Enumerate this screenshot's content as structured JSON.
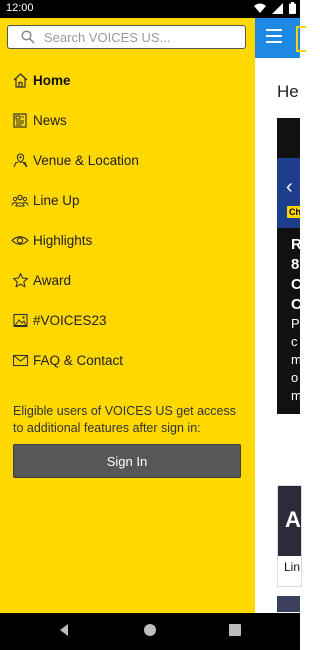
{
  "status_bar": {
    "time": "12:00"
  },
  "drawer": {
    "search": {
      "placeholder": "Search VOICES US..."
    },
    "items": [
      {
        "label": "Home",
        "icon": "home-icon",
        "active": true
      },
      {
        "label": "News",
        "icon": "news-icon"
      },
      {
        "label": "Venue & Location",
        "icon": "location-map-icon"
      },
      {
        "label": "Line Up",
        "icon": "people-icon"
      },
      {
        "label": "Highlights",
        "icon": "eye-icon"
      },
      {
        "label": "Award",
        "icon": "star-icon"
      },
      {
        "label": "#VOICES23",
        "icon": "image-icon"
      },
      {
        "label": "FAQ & Contact",
        "icon": "mail-icon"
      }
    ],
    "info_text": "Eligible users of VOICES US get access to additional features after sign in:",
    "sign_in_label": "Sign In"
  },
  "background": {
    "heading": "He",
    "hero": {
      "tag": "Ch",
      "lines": [
        "R",
        "8",
        "C",
        "C"
      ],
      "sub_lines": [
        "P",
        "c",
        "m",
        "o",
        "m"
      ],
      "chevron": "‹"
    },
    "card": {
      "image_text": "A",
      "caption": "Lin"
    }
  },
  "colors": {
    "drawer_bg": "#ffd800",
    "app_bar": "#1e88e5",
    "button_bg": "#575757"
  }
}
